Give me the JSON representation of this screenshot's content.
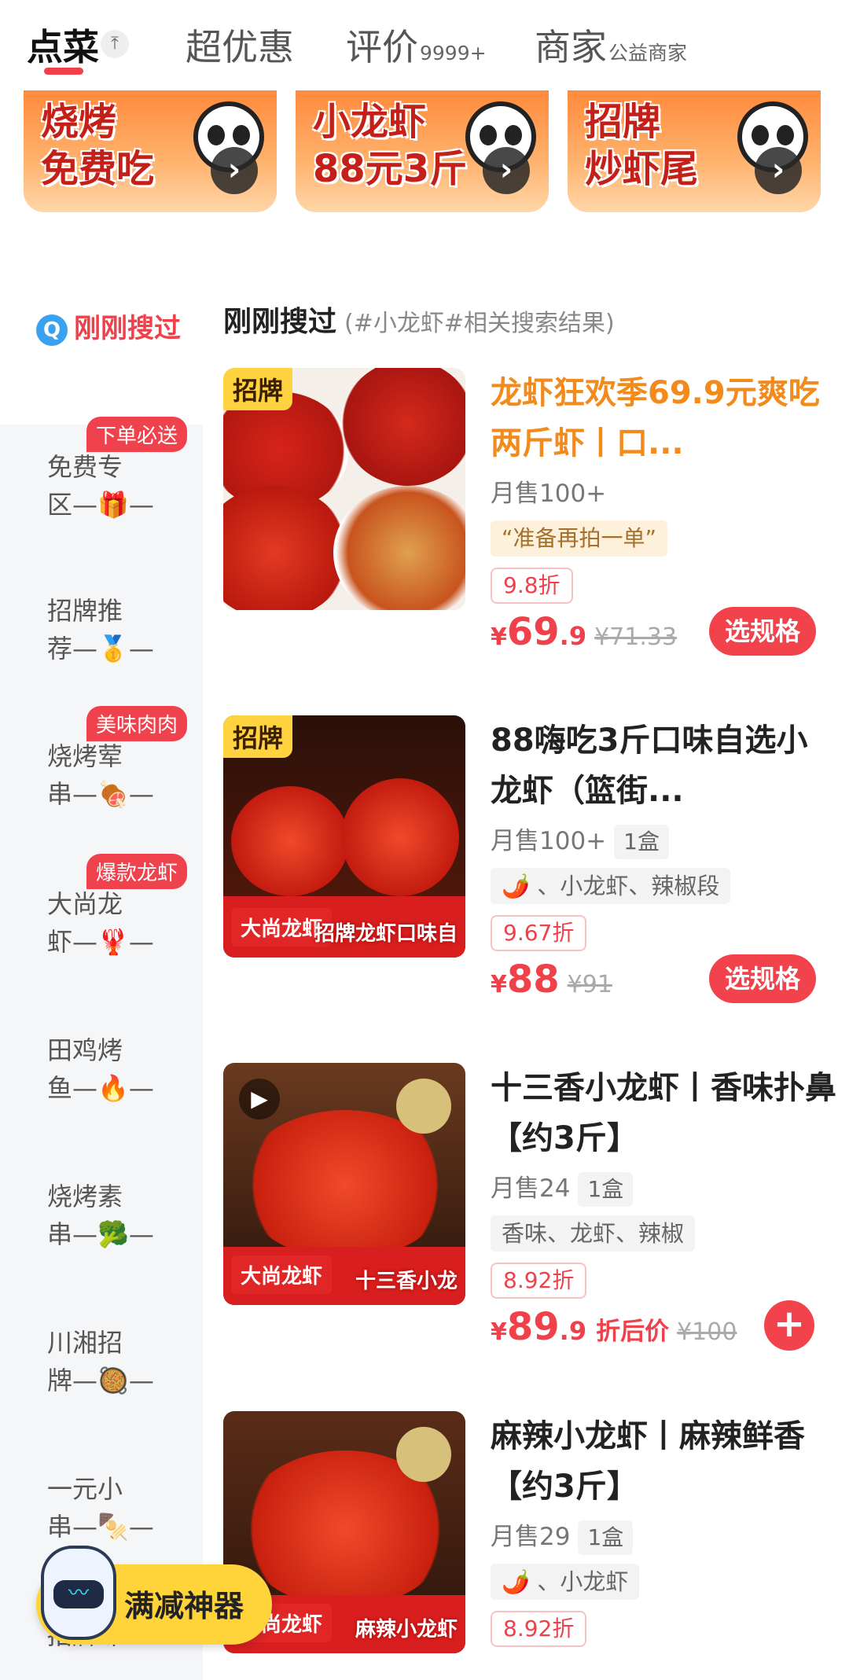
{
  "tabs": {
    "order": {
      "label": "点菜"
    },
    "deals": {
      "label": "超优惠"
    },
    "reviews": {
      "label": "评价",
      "count": "9999+"
    },
    "merchant": {
      "label": "商家",
      "sub": "公益商家"
    }
  },
  "banners": [
    {
      "line1": "烧烤",
      "line2": "免费吃"
    },
    {
      "line1": "小龙虾",
      "line2": "88元3斤"
    },
    {
      "line1": "招牌",
      "line2": "炒虾尾"
    }
  ],
  "sidebar": {
    "recent_label": "刚刚搜过",
    "items": [
      {
        "line1": "免费专",
        "line2": "区—🎁—",
        "badge": "下单必送"
      },
      {
        "line1": "招牌推",
        "line2": "荐—🥇—",
        "badge": ""
      },
      {
        "line1": "烧烤荤",
        "line2": "串—🍖—",
        "badge": "美味肉肉"
      },
      {
        "line1": "大尚龙",
        "line2": "虾—🦞—",
        "badge": "爆款龙虾"
      },
      {
        "line1": "田鸡烤",
        "line2": "鱼—🔥—",
        "badge": ""
      },
      {
        "line1": "烧烤素",
        "line2": "串—🥦—",
        "badge": ""
      },
      {
        "line1": "川湘招",
        "line2": "牌—🥘—",
        "badge": ""
      },
      {
        "line1": "一元小",
        "line2": "串—🍢—",
        "badge": ""
      },
      {
        "line1": "招牌虾",
        "line2": "",
        "badge": ""
      }
    ]
  },
  "section": {
    "title": "刚刚搜过",
    "subtitle": "(#小龙虾#相关搜索结果)"
  },
  "products": [
    {
      "tag": "招牌",
      "name": "龙虾狂欢季69.9元爽吃两斤虾丨口...",
      "sales": "月售100+",
      "note": "“准备再拍一单”",
      "discount": "9.8折",
      "price_cur": "¥",
      "price_int": "69",
      "price_dec": ".9",
      "orig_price": "¥71.33",
      "button": "选规格"
    },
    {
      "tag": "招牌",
      "name": "88嗨吃3斤口味自选小龙虾（篮街...",
      "sales": "月售100+",
      "box": "1盒",
      "tags": "🌶️ 、小龙虾、辣椒段",
      "discount": "9.67折",
      "price_cur": "¥",
      "price_int": "88",
      "orig_price": "¥91",
      "button": "选规格",
      "brand": "大尚龙虾",
      "img_caption": "招牌龙虾口味自"
    },
    {
      "name": "十三香小龙虾丨香味扑鼻【约3斤】",
      "sales": "月售24",
      "box": "1盒",
      "tags": "香味、龙虾、辣椒",
      "discount": "8.92折",
      "price_cur": "¥",
      "price_int": "89",
      "price_dec": ".9",
      "after_label": "折后价",
      "orig_price": "¥100",
      "brand": "大尚龙虾",
      "img_caption": "十三香小龙"
    },
    {
      "name": "麻辣小龙虾丨麻辣鲜香【约3斤】",
      "sales": "月售29",
      "box": "1盒",
      "tags": "🌶️ 、小龙虾",
      "discount": "8.92折",
      "brand": "大尚龙虾",
      "img_caption": "麻辣小龙虾"
    }
  ],
  "floating": {
    "label": "满减神器"
  },
  "icons": {
    "collapse": "arrow-up-icon",
    "banner_arrow": "chevron-right-icon",
    "search": "search-icon",
    "play": "play-icon",
    "add": "plus-icon"
  },
  "colors": {
    "accent": "#f2424b",
    "highlight_title": "#f28a1c",
    "tag_bg": "#ffd23f"
  }
}
